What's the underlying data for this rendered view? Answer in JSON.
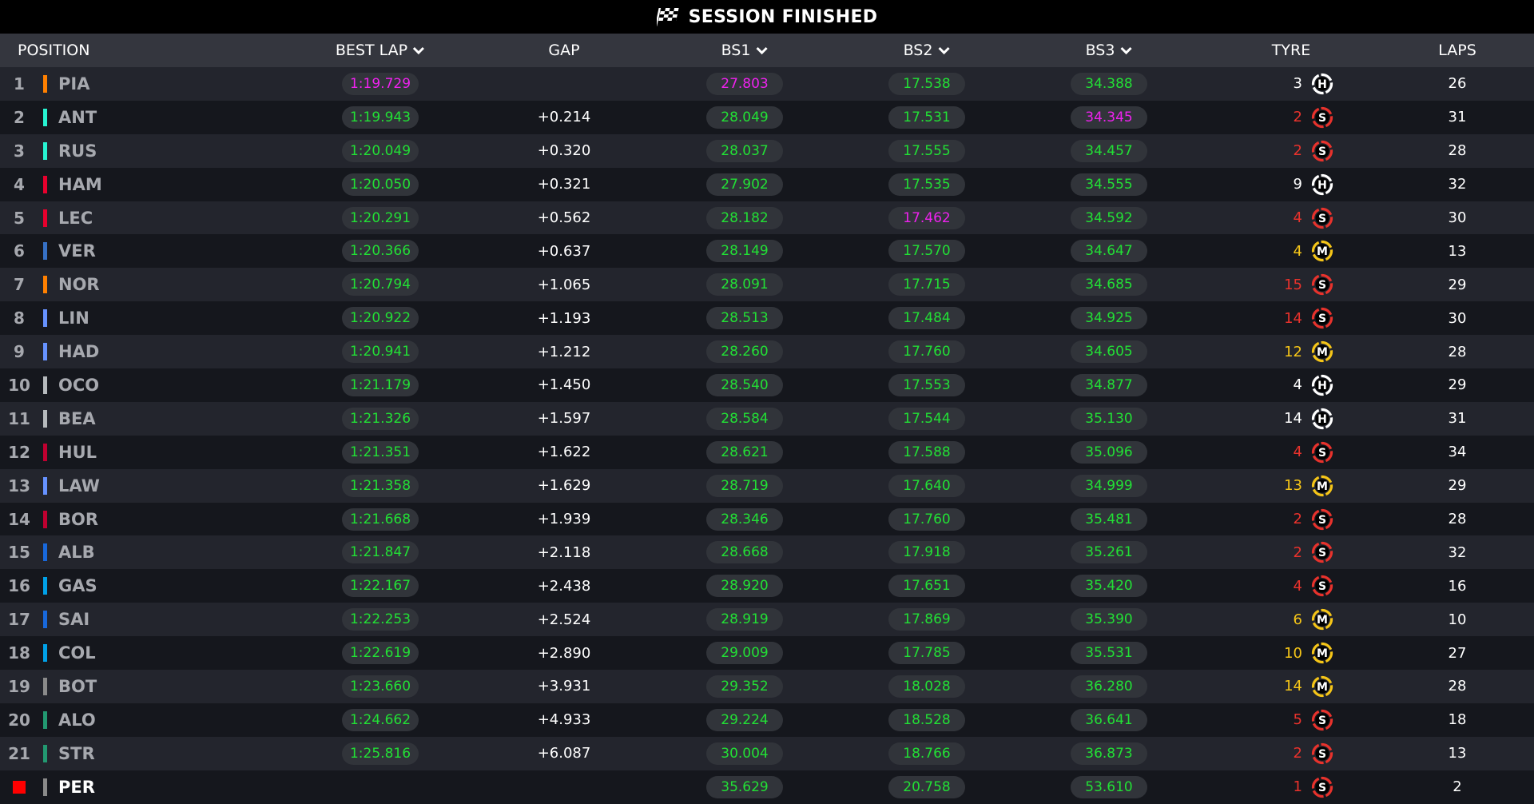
{
  "session": {
    "title": "SESSION FINISHED"
  },
  "columns": {
    "position": "POSITION",
    "best_lap": "BEST LAP",
    "gap": "GAP",
    "bs1": "BS1",
    "bs2": "BS2",
    "bs3": "BS3",
    "tyre": "TYRE",
    "laps": "LAPS"
  },
  "colors": {
    "green_time": "#22e035",
    "purple_time": "#ee22ee",
    "soft": "#e8322c",
    "medium": "#f5c518",
    "hard": "#ffffff"
  },
  "rows": [
    {
      "pos": "1",
      "team_color": "#ff8000",
      "driver": "PIA",
      "best_lap": "1:19.729",
      "bl_purple": true,
      "gap": "",
      "bs1": "27.803",
      "bs1_purple": true,
      "bs2": "17.538",
      "bs2_purple": false,
      "bs3": "34.388",
      "bs3_purple": false,
      "tyre_laps": "3",
      "compound": "H",
      "laps": "26"
    },
    {
      "pos": "2",
      "team_color": "#27f4d2",
      "driver": "ANT",
      "best_lap": "1:19.943",
      "bl_purple": false,
      "gap": "+0.214",
      "bs1": "28.049",
      "bs1_purple": false,
      "bs2": "17.531",
      "bs2_purple": false,
      "bs3": "34.345",
      "bs3_purple": true,
      "tyre_laps": "2",
      "compound": "S",
      "laps": "31"
    },
    {
      "pos": "3",
      "team_color": "#27f4d2",
      "driver": "RUS",
      "best_lap": "1:20.049",
      "bl_purple": false,
      "gap": "+0.320",
      "bs1": "28.037",
      "bs1_purple": false,
      "bs2": "17.555",
      "bs2_purple": false,
      "bs3": "34.457",
      "bs3_purple": false,
      "tyre_laps": "2",
      "compound": "S",
      "laps": "28"
    },
    {
      "pos": "4",
      "team_color": "#e8002d",
      "driver": "HAM",
      "best_lap": "1:20.050",
      "bl_purple": false,
      "gap": "+0.321",
      "bs1": "27.902",
      "bs1_purple": false,
      "bs2": "17.535",
      "bs2_purple": false,
      "bs3": "34.555",
      "bs3_purple": false,
      "tyre_laps": "9",
      "compound": "H",
      "laps": "32"
    },
    {
      "pos": "5",
      "team_color": "#e8002d",
      "driver": "LEC",
      "best_lap": "1:20.291",
      "bl_purple": false,
      "gap": "+0.562",
      "bs1": "28.182",
      "bs1_purple": false,
      "bs2": "17.462",
      "bs2_purple": true,
      "bs3": "34.592",
      "bs3_purple": false,
      "tyre_laps": "4",
      "compound": "S",
      "laps": "30"
    },
    {
      "pos": "6",
      "team_color": "#3671c6",
      "driver": "VER",
      "best_lap": "1:20.366",
      "bl_purple": false,
      "gap": "+0.637",
      "bs1": "28.149",
      "bs1_purple": false,
      "bs2": "17.570",
      "bs2_purple": false,
      "bs3": "34.647",
      "bs3_purple": false,
      "tyre_laps": "4",
      "compound": "M",
      "laps": "13"
    },
    {
      "pos": "7",
      "team_color": "#ff8000",
      "driver": "NOR",
      "best_lap": "1:20.794",
      "bl_purple": false,
      "gap": "+1.065",
      "bs1": "28.091",
      "bs1_purple": false,
      "bs2": "17.715",
      "bs2_purple": false,
      "bs3": "34.685",
      "bs3_purple": false,
      "tyre_laps": "15",
      "compound": "S",
      "laps": "29"
    },
    {
      "pos": "8",
      "team_color": "#6692ff",
      "driver": "LIN",
      "best_lap": "1:20.922",
      "bl_purple": false,
      "gap": "+1.193",
      "bs1": "28.513",
      "bs1_purple": false,
      "bs2": "17.484",
      "bs2_purple": false,
      "bs3": "34.925",
      "bs3_purple": false,
      "tyre_laps": "14",
      "compound": "S",
      "laps": "30"
    },
    {
      "pos": "9",
      "team_color": "#6692ff",
      "driver": "HAD",
      "best_lap": "1:20.941",
      "bl_purple": false,
      "gap": "+1.212",
      "bs1": "28.260",
      "bs1_purple": false,
      "bs2": "17.760",
      "bs2_purple": false,
      "bs3": "34.605",
      "bs3_purple": false,
      "tyre_laps": "12",
      "compound": "M",
      "laps": "28"
    },
    {
      "pos": "10",
      "team_color": "#b6babd",
      "driver": "OCO",
      "best_lap": "1:21.179",
      "bl_purple": false,
      "gap": "+1.450",
      "bs1": "28.540",
      "bs1_purple": false,
      "bs2": "17.553",
      "bs2_purple": false,
      "bs3": "34.877",
      "bs3_purple": false,
      "tyre_laps": "4",
      "compound": "H",
      "laps": "29"
    },
    {
      "pos": "11",
      "team_color": "#b6babd",
      "driver": "BEA",
      "best_lap": "1:21.326",
      "bl_purple": false,
      "gap": "+1.597",
      "bs1": "28.584",
      "bs1_purple": false,
      "bs2": "17.544",
      "bs2_purple": false,
      "bs3": "35.130",
      "bs3_purple": false,
      "tyre_laps": "14",
      "compound": "H",
      "laps": "31"
    },
    {
      "pos": "12",
      "team_color": "#c00030",
      "driver": "HUL",
      "best_lap": "1:21.351",
      "bl_purple": false,
      "gap": "+1.622",
      "bs1": "28.621",
      "bs1_purple": false,
      "bs2": "17.588",
      "bs2_purple": false,
      "bs3": "35.096",
      "bs3_purple": false,
      "tyre_laps": "4",
      "compound": "S",
      "laps": "34"
    },
    {
      "pos": "13",
      "team_color": "#6692ff",
      "driver": "LAW",
      "best_lap": "1:21.358",
      "bl_purple": false,
      "gap": "+1.629",
      "bs1": "28.719",
      "bs1_purple": false,
      "bs2": "17.640",
      "bs2_purple": false,
      "bs3": "34.999",
      "bs3_purple": false,
      "tyre_laps": "13",
      "compound": "M",
      "laps": "29"
    },
    {
      "pos": "14",
      "team_color": "#c00030",
      "driver": "BOR",
      "best_lap": "1:21.668",
      "bl_purple": false,
      "gap": "+1.939",
      "bs1": "28.346",
      "bs1_purple": false,
      "bs2": "17.760",
      "bs2_purple": false,
      "bs3": "35.481",
      "bs3_purple": false,
      "tyre_laps": "2",
      "compound": "S",
      "laps": "28"
    },
    {
      "pos": "15",
      "team_color": "#1868db",
      "driver": "ALB",
      "best_lap": "1:21.847",
      "bl_purple": false,
      "gap": "+2.118",
      "bs1": "28.668",
      "bs1_purple": false,
      "bs2": "17.918",
      "bs2_purple": false,
      "bs3": "35.261",
      "bs3_purple": false,
      "tyre_laps": "2",
      "compound": "S",
      "laps": "32"
    },
    {
      "pos": "16",
      "team_color": "#00a1e8",
      "driver": "GAS",
      "best_lap": "1:22.167",
      "bl_purple": false,
      "gap": "+2.438",
      "bs1": "28.920",
      "bs1_purple": false,
      "bs2": "17.651",
      "bs2_purple": false,
      "bs3": "35.420",
      "bs3_purple": false,
      "tyre_laps": "4",
      "compound": "S",
      "laps": "16"
    },
    {
      "pos": "17",
      "team_color": "#1868db",
      "driver": "SAI",
      "best_lap": "1:22.253",
      "bl_purple": false,
      "gap": "+2.524",
      "bs1": "28.919",
      "bs1_purple": false,
      "bs2": "17.869",
      "bs2_purple": false,
      "bs3": "35.390",
      "bs3_purple": false,
      "tyre_laps": "6",
      "compound": "M",
      "laps": "10"
    },
    {
      "pos": "18",
      "team_color": "#00a1e8",
      "driver": "COL",
      "best_lap": "1:22.619",
      "bl_purple": false,
      "gap": "+2.890",
      "bs1": "29.009",
      "bs1_purple": false,
      "bs2": "17.785",
      "bs2_purple": false,
      "bs3": "35.531",
      "bs3_purple": false,
      "tyre_laps": "10",
      "compound": "M",
      "laps": "27"
    },
    {
      "pos": "19",
      "team_color": "#8a8a8a",
      "driver": "BOT",
      "best_lap": "1:23.660",
      "bl_purple": false,
      "gap": "+3.931",
      "bs1": "29.352",
      "bs1_purple": false,
      "bs2": "18.028",
      "bs2_purple": false,
      "bs3": "36.280",
      "bs3_purple": false,
      "tyre_laps": "14",
      "compound": "M",
      "laps": "28"
    },
    {
      "pos": "20",
      "team_color": "#229971",
      "driver": "ALO",
      "best_lap": "1:24.662",
      "bl_purple": false,
      "gap": "+4.933",
      "bs1": "29.224",
      "bs1_purple": false,
      "bs2": "18.528",
      "bs2_purple": false,
      "bs3": "36.641",
      "bs3_purple": false,
      "tyre_laps": "5",
      "compound": "S",
      "laps": "18"
    },
    {
      "pos": "21",
      "team_color": "#229971",
      "driver": "STR",
      "best_lap": "1:25.816",
      "bl_purple": false,
      "gap": "+6.087",
      "bs1": "30.004",
      "bs1_purple": false,
      "bs2": "18.766",
      "bs2_purple": false,
      "bs3": "36.873",
      "bs3_purple": false,
      "tyre_laps": "2",
      "compound": "S",
      "laps": "13"
    },
    {
      "pos": "",
      "retired": true,
      "team_color": "#8a8a8a",
      "driver": "PER",
      "best_lap": "",
      "bl_purple": false,
      "gap": "",
      "bs1": "35.629",
      "bs1_purple": false,
      "bs2": "20.758",
      "bs2_purple": false,
      "bs3": "53.610",
      "bs3_purple": false,
      "tyre_laps": "1",
      "compound": "S",
      "laps": "2"
    }
  ]
}
